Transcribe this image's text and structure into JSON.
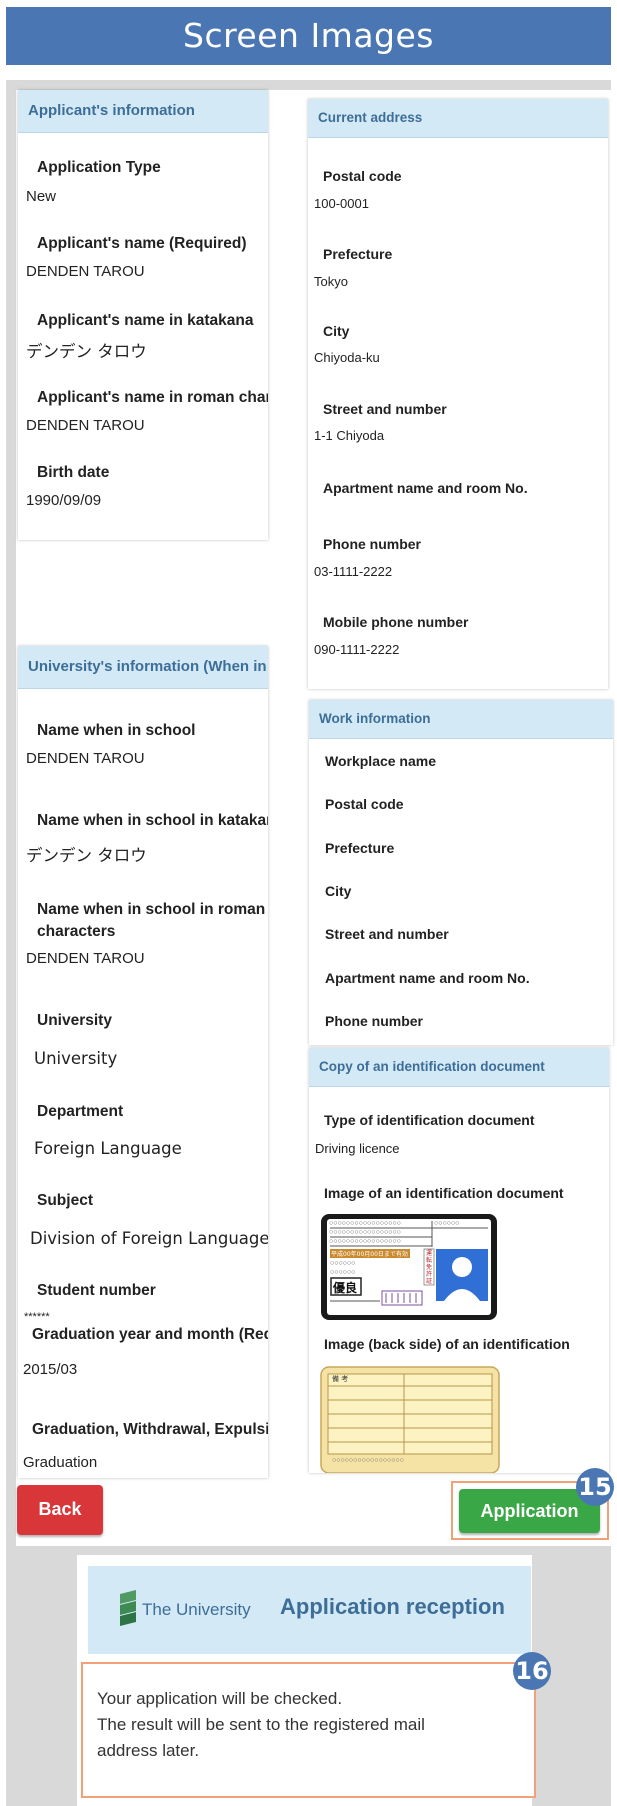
{
  "page_title": "Screen Images",
  "applicant": {
    "header": "Applicant's information",
    "fields": [
      {
        "label": "Application Type",
        "value": "New"
      },
      {
        "label": "Applicant's name (Required)",
        "value": "DENDEN TAROU"
      },
      {
        "label": "Applicant's name in katakana",
        "value": "デンデン タロウ"
      },
      {
        "label": "Applicant's name in roman charac",
        "value": "DENDEN TAROU"
      },
      {
        "label": "Birth date",
        "value": "1990/09/09"
      }
    ]
  },
  "university": {
    "header": "University's information (When in s",
    "fields": [
      {
        "label": "Name when in school",
        "value": "DENDEN TAROU"
      },
      {
        "label": "Name when in school in katakana",
        "value": "デンデン タロウ"
      },
      {
        "label": "Name when in school in roman",
        "label2": "characters",
        "value": "DENDEN TAROU"
      },
      {
        "label": "University",
        "value": "University"
      },
      {
        "label": "Department",
        "value": "Foreign Language"
      },
      {
        "label": "Subject",
        "value": "Division of Foreign Language"
      },
      {
        "label": "Student number",
        "value": "******"
      },
      {
        "label": "Graduation year and month (Requi",
        "value": "2015/03"
      },
      {
        "label": "Graduation, Withdrawal, Expulsior",
        "value": "Graduation"
      }
    ]
  },
  "address": {
    "header": "Current address",
    "fields": [
      {
        "label": "Postal code",
        "value": "100-0001"
      },
      {
        "label": "Prefecture",
        "value": "Tokyo"
      },
      {
        "label": "City",
        "value": "Chiyoda-ku"
      },
      {
        "label": "Street and number",
        "value": "1-1 Chiyoda"
      },
      {
        "label": "Apartment name and room No.",
        "value": ""
      },
      {
        "label": "Phone number",
        "value": "03-1111-2222"
      },
      {
        "label": "Mobile phone number",
        "value": "090-1111-2222"
      }
    ]
  },
  "work": {
    "header": "Work information",
    "fields": [
      "Workplace name",
      "Postal code",
      "Prefecture",
      "City",
      "Street and number",
      "Apartment name and room No.",
      "Phone number"
    ]
  },
  "idcopy": {
    "header": "Copy of an identification document",
    "type_label": "Type of identification document",
    "type_value": "Driving licence",
    "image_label": "Image of an identification document",
    "back_label": "Image (back side) of an identification",
    "card_status": "優良",
    "card_side_text": "運転免許証",
    "back_title": "備 考",
    "placeholder": "○○○○○○○○○○○○○○○○○",
    "placeholder_short": "○○○○○○",
    "date_strip": "平成00年00月00日まで有効"
  },
  "buttons": {
    "back": "Back",
    "application": "Application"
  },
  "badges": {
    "b15": "15",
    "b16": "16"
  },
  "reception": {
    "logo_text": "The University",
    "title": "Application reception",
    "message_lines": [
      "Your application will be checked.",
      "The result will be sent to the registered mail",
      "address later."
    ]
  },
  "colors": {
    "header_bar": "#4a76b3",
    "panel_head": "#d4e9f6",
    "accent_text": "#3d6e98",
    "back_btn": "#d9363a",
    "app_btn": "#3aa746",
    "highlight": "#f0a178"
  }
}
